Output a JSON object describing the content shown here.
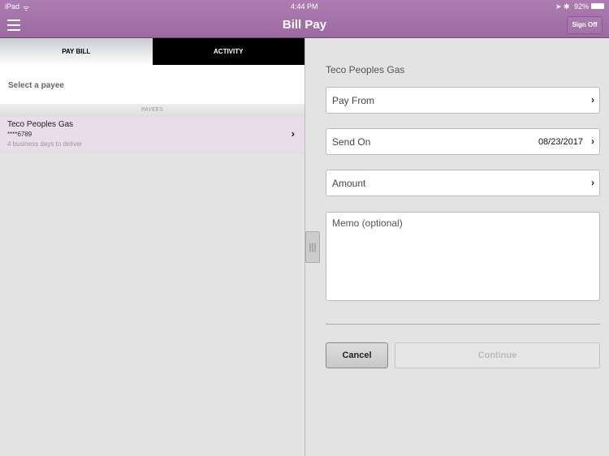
{
  "status": {
    "device": "iPad",
    "time": "4:44 PM",
    "battery": "92%"
  },
  "header": {
    "title": "Bill Pay",
    "sign_off": "Sign Off"
  },
  "tabs": [
    {
      "label": "PAY BILL"
    },
    {
      "label": "ACTIVITY"
    }
  ],
  "left": {
    "select_label": "Select a payee",
    "section": "PAYEES",
    "payees": [
      {
        "name": "Teco Peoples Gas",
        "account": "****6789",
        "delivery": "4 business days to deliver"
      }
    ]
  },
  "form": {
    "payee": "Teco Peoples Gas",
    "pay_from": "Pay From",
    "send_on": "Send On",
    "send_on_value": "08/23/2017",
    "amount": "Amount",
    "memo_placeholder": "Memo (optional)",
    "cancel": "Cancel",
    "continue": "Continue"
  }
}
